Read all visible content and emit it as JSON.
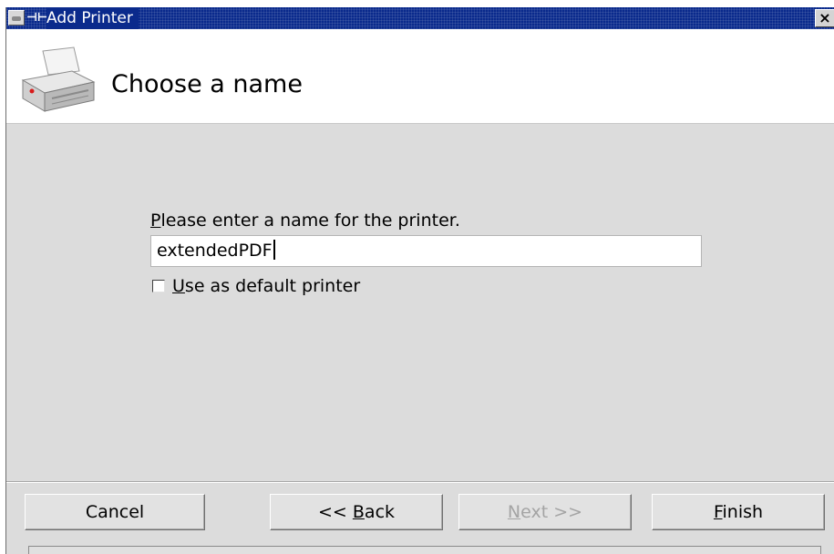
{
  "window": {
    "title": "Add Printer",
    "close_label": "×"
  },
  "header": {
    "heading": "Choose a name",
    "icon": "printer-icon"
  },
  "form": {
    "prompt": {
      "mnemonic": "P",
      "rest": "lease enter a name for the printer."
    },
    "printer_name": {
      "value": "extendedPDF"
    },
    "default_checkbox": {
      "checked": false,
      "mnemonic": "U",
      "rest": "se as default printer"
    }
  },
  "buttons": {
    "cancel": {
      "label": "Cancel",
      "enabled": true
    },
    "back": {
      "prefix": "<< ",
      "mnemonic": "B",
      "rest": "ack",
      "enabled": true
    },
    "next": {
      "mnemonic": "N",
      "rest": "ext >>",
      "enabled": false
    },
    "finish": {
      "mnemonic": "F",
      "rest": "inish",
      "enabled": true
    }
  },
  "colors": {
    "titlebar": "#0a2a8c",
    "dialog_background": "#dcdcdc",
    "header_background": "#ffffff",
    "disabled_text": "#a4a4a4"
  }
}
